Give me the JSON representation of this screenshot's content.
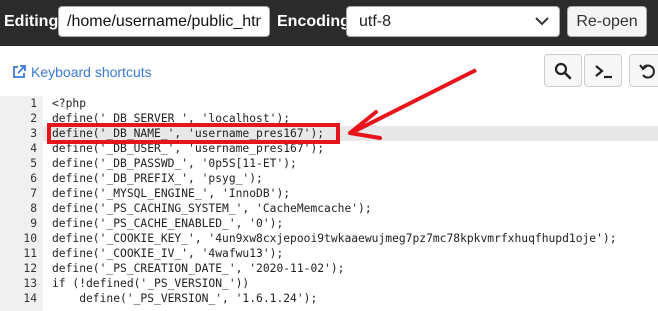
{
  "topbar": {
    "editing_label": "Editing:",
    "path_value": "/home/username/public_html/config/settings.inc.php",
    "encoding_label": "Encoding:",
    "encoding_value": "utf-8",
    "reopen_label": "Re-open"
  },
  "toolbar": {
    "keyboard_shortcuts": "Keyboard shortcuts",
    "icons": [
      "search-icon",
      "terminal-icon",
      "undo-icon"
    ]
  },
  "editor": {
    "active_line": 3,
    "lines": [
      {
        "num": "1",
        "code": "<?php"
      },
      {
        "num": "2",
        "code": "define('_DB_SERVER_', 'localhost');"
      },
      {
        "num": "3",
        "code": "define('_DB_NAME_', 'username_pres167');"
      },
      {
        "num": "4",
        "code": "define('_DB_USER_', 'username_pres167');"
      },
      {
        "num": "5",
        "code": "define('_DB_PASSWD_', '0p5S[11-ET');"
      },
      {
        "num": "6",
        "code": "define('_DB_PREFIX_', 'psyg_');"
      },
      {
        "num": "7",
        "code": "define('_MYSQL_ENGINE_', 'InnoDB');"
      },
      {
        "num": "8",
        "code": "define('_PS_CACHING_SYSTEM_', 'CacheMemcache');"
      },
      {
        "num": "9",
        "code": "define('_PS_CACHE_ENABLED_', '0');"
      },
      {
        "num": "10",
        "code": "define('_COOKIE_KEY_', '4un9xw8cxjepooi9twkaaewujmeg7pz7mc78kpkvmrfxhuqfhupd1oje');"
      },
      {
        "num": "11",
        "code": "define('_COOKIE_IV_', '4wafwu13');"
      },
      {
        "num": "12",
        "code": "define('_PS_CREATION_DATE_', '2020-11-02');"
      },
      {
        "num": "13",
        "code": "if (!defined('_PS_VERSION_'))"
      },
      {
        "num": "14",
        "code": "    define('_PS_VERSION_', '1.6.1.24');"
      }
    ]
  },
  "annotation": {
    "color": "#e8141b"
  },
  "colors": {
    "topbar_bg": "#2b2b2b",
    "link": "#3a7bd5",
    "keyword": "#7a2a9a",
    "string": "#1a1aa6"
  }
}
